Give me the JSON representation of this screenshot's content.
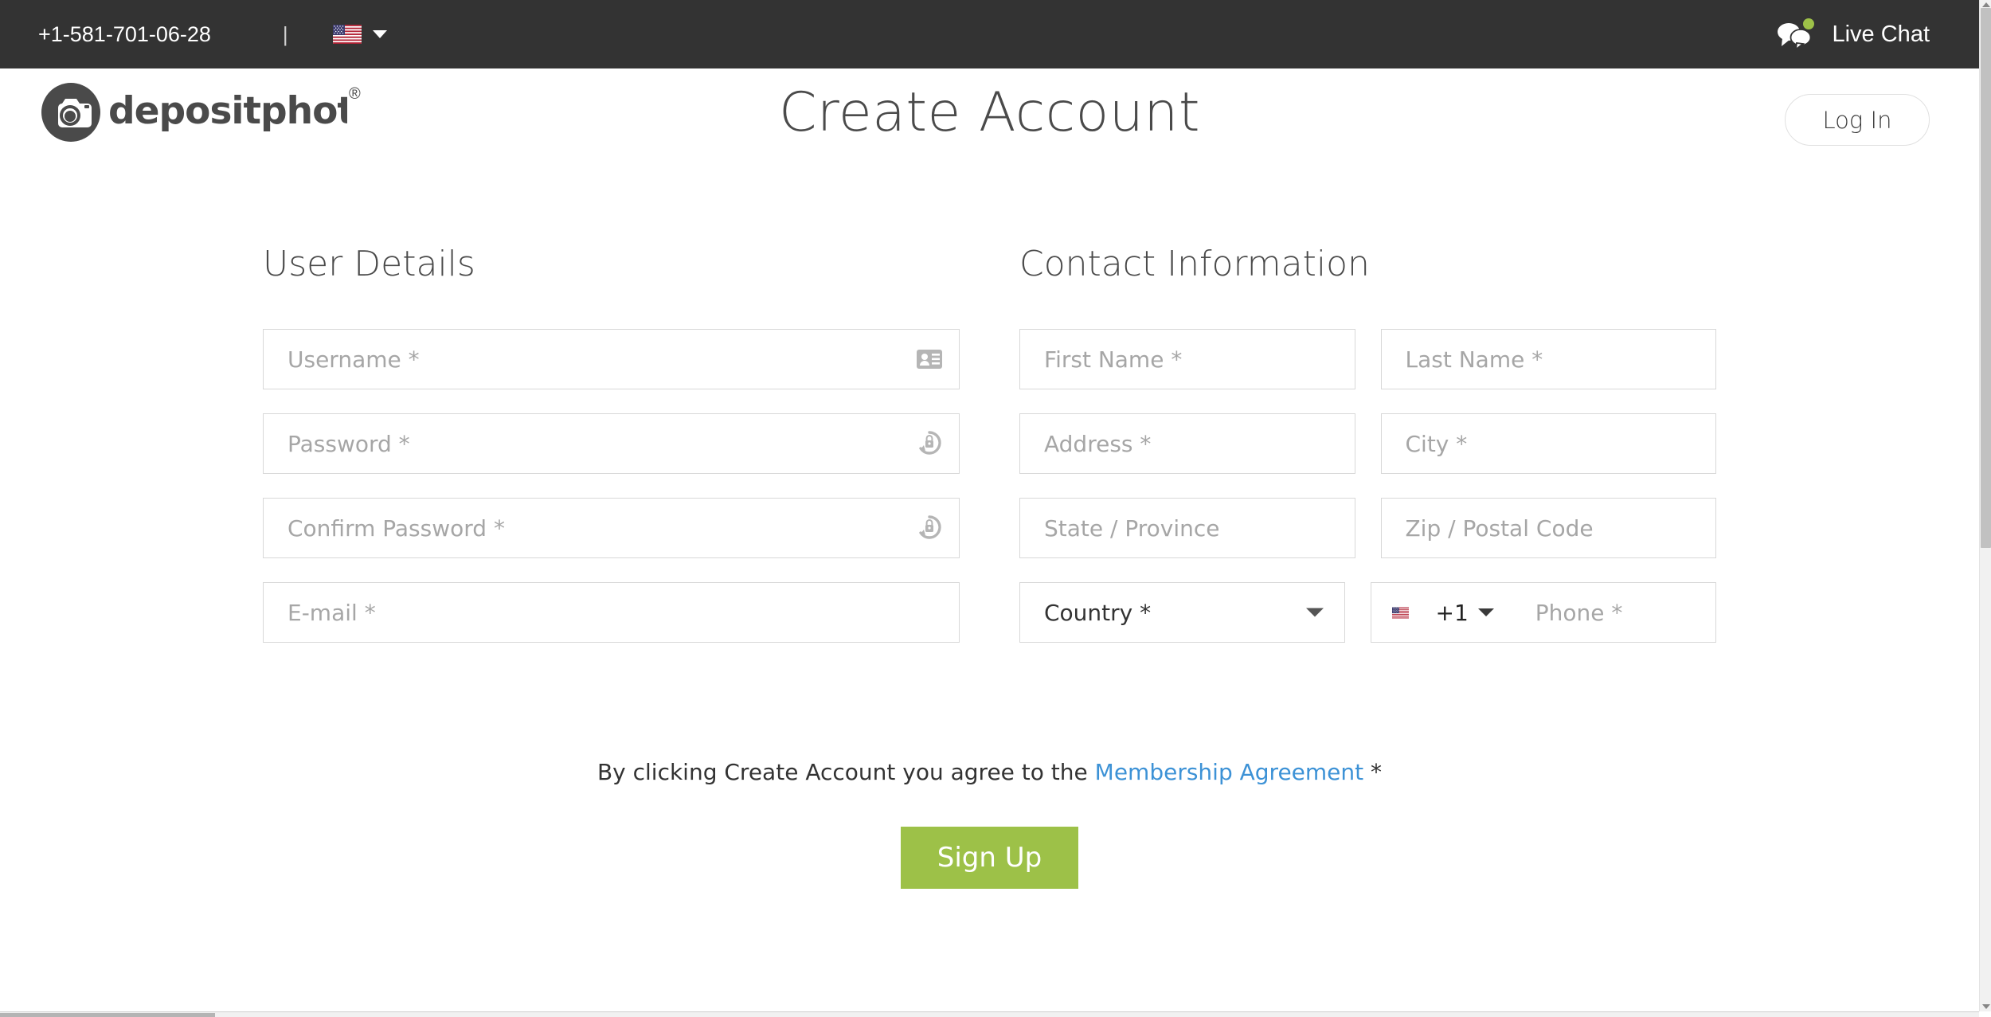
{
  "topbar": {
    "phone": "+1-581-701-06-28",
    "divider": "|",
    "language_flag": "us-flag-icon",
    "language_caret": "chevron-down-icon",
    "live_chat_label": "Live Chat",
    "live_chat_icon": "chat-bubbles-icon",
    "status_dot_color": "#9dc148",
    "background": "#333333"
  },
  "header": {
    "logo_text": "depositphotos",
    "logo_registered": "®",
    "logo_icon": "camera-icon",
    "title": "Create Account",
    "login_label": "Log In"
  },
  "form": {
    "user_details": {
      "heading": "User Details",
      "fields": [
        {
          "name": "username",
          "placeholder": "Username *",
          "value": "",
          "icon": "id-card-icon"
        },
        {
          "name": "password",
          "placeholder": "Password *",
          "value": "",
          "icon": "lock-refresh-icon"
        },
        {
          "name": "confirm-password",
          "placeholder": "Confirm Password *",
          "value": "",
          "icon": "lock-refresh-icon"
        },
        {
          "name": "email",
          "placeholder": "E-mail *",
          "value": "",
          "icon": ""
        }
      ]
    },
    "contact_information": {
      "heading": "Contact Information",
      "fields": [
        {
          "name": "first-name",
          "placeholder": "First Name *",
          "value": ""
        },
        {
          "name": "last-name",
          "placeholder": "Last Name *",
          "value": ""
        },
        {
          "name": "address",
          "placeholder": "Address *",
          "value": ""
        },
        {
          "name": "city",
          "placeholder": "City *",
          "value": ""
        },
        {
          "name": "state-province",
          "placeholder": "State / Province",
          "value": ""
        },
        {
          "name": "zip-postal-code",
          "placeholder": "Zip / Postal Code",
          "value": ""
        }
      ],
      "country": {
        "label": "Country *",
        "caret": "chevron-down-icon"
      },
      "phone": {
        "flag": "us-flag-icon",
        "dial_code": "+1",
        "caret": "chevron-down-icon",
        "placeholder": "Phone *",
        "value": ""
      }
    }
  },
  "footer": {
    "agreement_prefix": "By clicking Create Account you agree to the ",
    "agreement_link": "Membership Agreement",
    "agreement_suffix": " *",
    "signup_label": "Sign Up",
    "signup_color": "#9dc148",
    "link_color": "#3d92d6"
  },
  "scrollbars": {
    "vertical_visible": true,
    "horizontal_visible": true
  }
}
